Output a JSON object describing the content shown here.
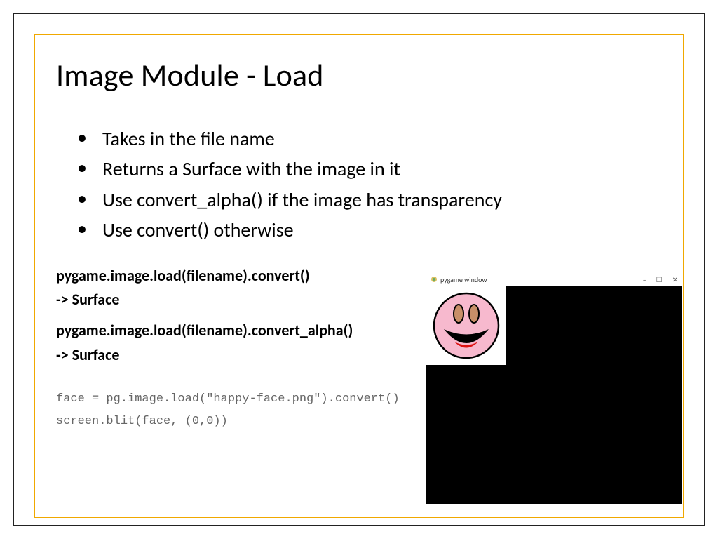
{
  "title": "Image Module - Load",
  "bullets": [
    "Takes in the file name",
    "Returns a Surface with the image in it",
    "Use convert_alpha() if the image has transparency",
    "Use convert() otherwise"
  ],
  "api1": {
    "sig": "pygame.image.load(filename).convert()",
    "ret": "-> Surface"
  },
  "api2": {
    "sig": "pygame.image.load(filename).convert_alpha()",
    "ret": "-> Surface"
  },
  "code": "face = pg.image.load(\"happy-face.png\").convert()\nscreen.blit(face, (0,0))",
  "pgwin": {
    "title": "pygame window",
    "minimize": "–",
    "maximize": "☐",
    "close": "✕"
  }
}
